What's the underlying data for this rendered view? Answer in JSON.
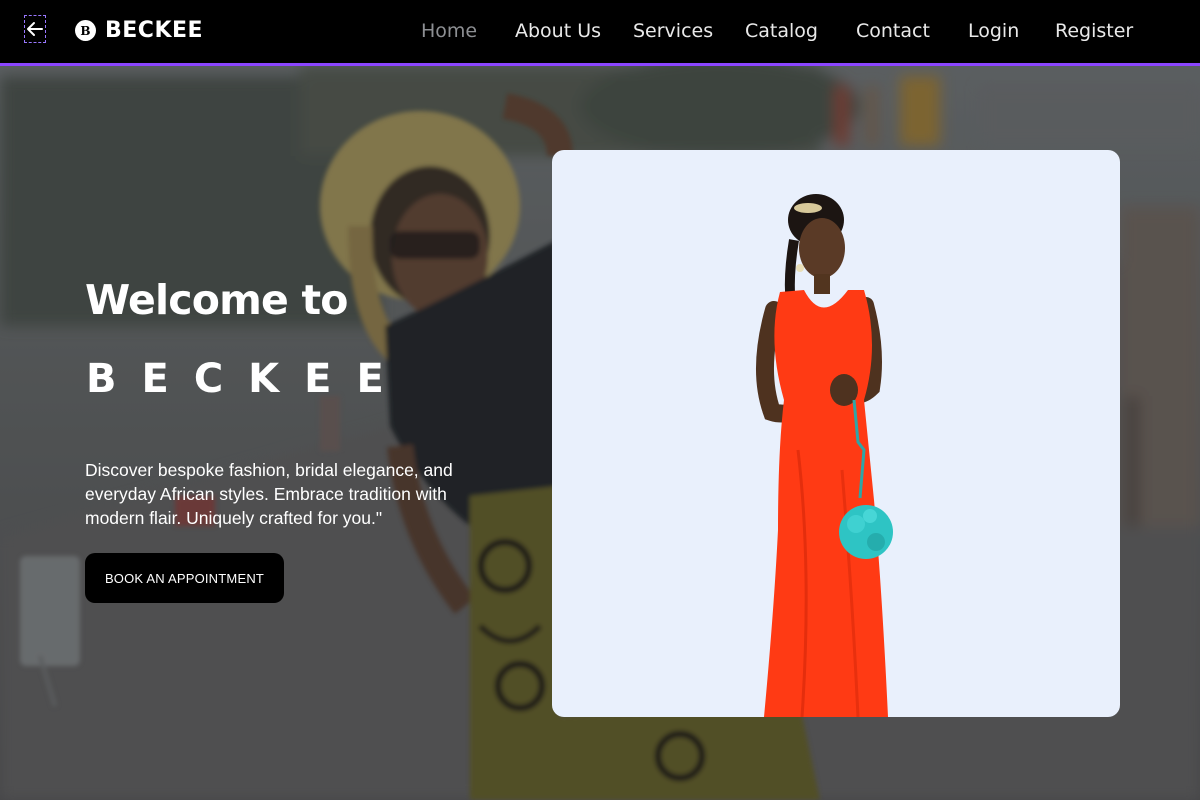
{
  "nav": {
    "brand": "BECKEE",
    "brand_logo_letter": "B",
    "links": [
      "Home",
      "About Us",
      "Services",
      "Catalog",
      "Contact",
      "Login",
      "Register"
    ],
    "active": "Home"
  },
  "hero": {
    "title": "Welcome to",
    "brand": "BECKEE",
    "description": "Discover bespoke fashion, bridal elegance, and everyday African styles. Embrace tradition with modern flair. Uniquely crafted for you.\"",
    "cta_label": "BOOK AN APPOINTMENT"
  },
  "colors": {
    "accent": "#8b45ff",
    "navbar_bg": "#000000",
    "card_bg": "#e9f0fc",
    "dress": "#ff3a14",
    "bouquet": "#2ec4c4"
  },
  "icons": {
    "back": "arrow-left-icon",
    "logo": "brand-logo-icon"
  }
}
